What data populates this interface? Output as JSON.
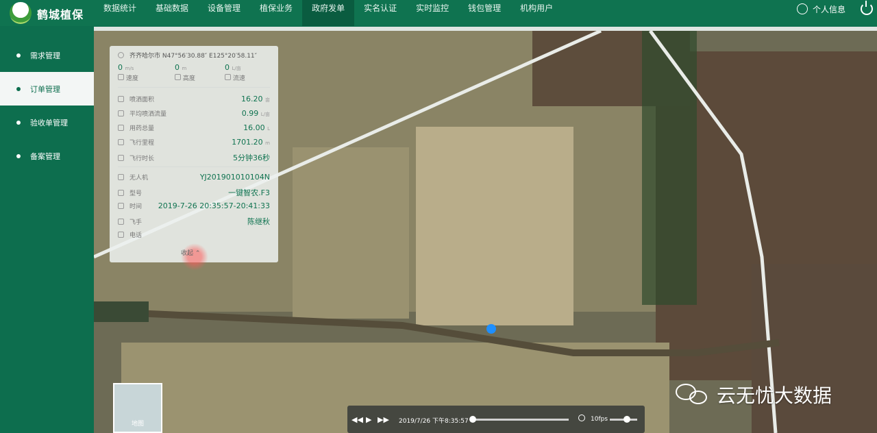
{
  "app": {
    "brand": "鹤城植保",
    "user_label": "个人信息"
  },
  "nav": {
    "items": [
      {
        "label": "数据统计"
      },
      {
        "label": "基础数据"
      },
      {
        "label": "设备管理"
      },
      {
        "label": "植保业务"
      },
      {
        "label": "政府发单",
        "active": true
      },
      {
        "label": "实名认证"
      },
      {
        "label": "实时监控"
      },
      {
        "label": "钱包管理"
      },
      {
        "label": "机构用户"
      }
    ]
  },
  "sidebar": {
    "items": [
      {
        "label": "需求管理"
      },
      {
        "label": "订单管理",
        "active": true
      },
      {
        "label": "验收单管理"
      },
      {
        "label": "备案管理"
      }
    ]
  },
  "panel": {
    "location": "齐齐哈尔市 N47°56′30.88″ E125°20′58.11″",
    "speed": {
      "value": "0",
      "unit": "m/s",
      "label": "速度"
    },
    "height": {
      "value": "0",
      "unit": "m",
      "label": "高度"
    },
    "flow": {
      "value": "0",
      "unit": "L/亩",
      "label": "流速"
    },
    "stats": [
      {
        "label": "喷洒面积",
        "value": "16.20",
        "unit": "亩"
      },
      {
        "label": "平均喷洒流量",
        "value": "0.99",
        "unit": "L/亩"
      },
      {
        "label": "用药总量",
        "value": "16.00",
        "unit": "L"
      },
      {
        "label": "飞行里程",
        "value": "1701.20",
        "unit": "m"
      },
      {
        "label": "飞行时长",
        "value": "5分钟36秒",
        "unit": ""
      }
    ],
    "info": [
      {
        "label": "无人机",
        "value": "YJ201901010104N"
      },
      {
        "label": "型号",
        "value": "一键智农.F3"
      },
      {
        "label": "时间",
        "value": "2019-7-26 20:35:57-20:41:33"
      },
      {
        "label": "飞手",
        "value": "陈继秋"
      },
      {
        "label": "电话",
        "value": ""
      }
    ],
    "collapse_label": "收起"
  },
  "minimap": {
    "label": "地图"
  },
  "player": {
    "timestamp": "2019/7/26 下午8:35:57",
    "fps": "10fps",
    "progress": 0
  },
  "watermark": {
    "text": "云无忧大数据"
  },
  "colors": {
    "brand_green": "#0f7350",
    "track_dot": "#1e8fff"
  }
}
